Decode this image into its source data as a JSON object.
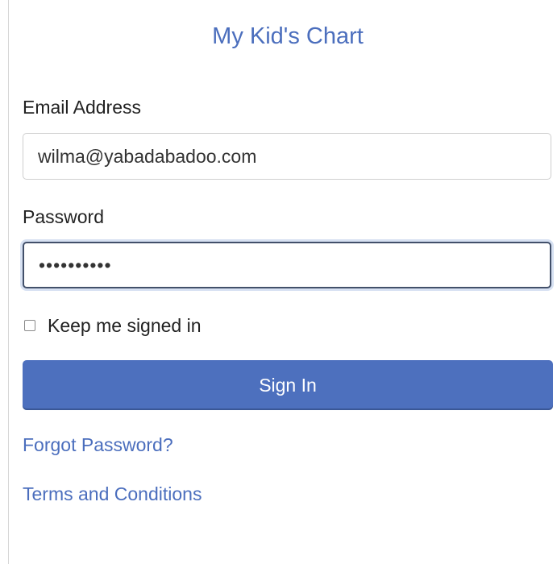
{
  "app": {
    "title": "My Kid's Chart"
  },
  "form": {
    "email": {
      "label": "Email Address",
      "value": "wilma@yabadabadoo.com"
    },
    "password": {
      "label": "Password",
      "masked_value": "••••••••••"
    },
    "remember": {
      "label": "Keep me signed in",
      "checked": false
    },
    "submit_label": "Sign In"
  },
  "links": {
    "forgot_password": "Forgot Password?",
    "terms": "Terms and Conditions"
  },
  "colors": {
    "accent": "#4b6ebd",
    "button": "#4d70be"
  }
}
